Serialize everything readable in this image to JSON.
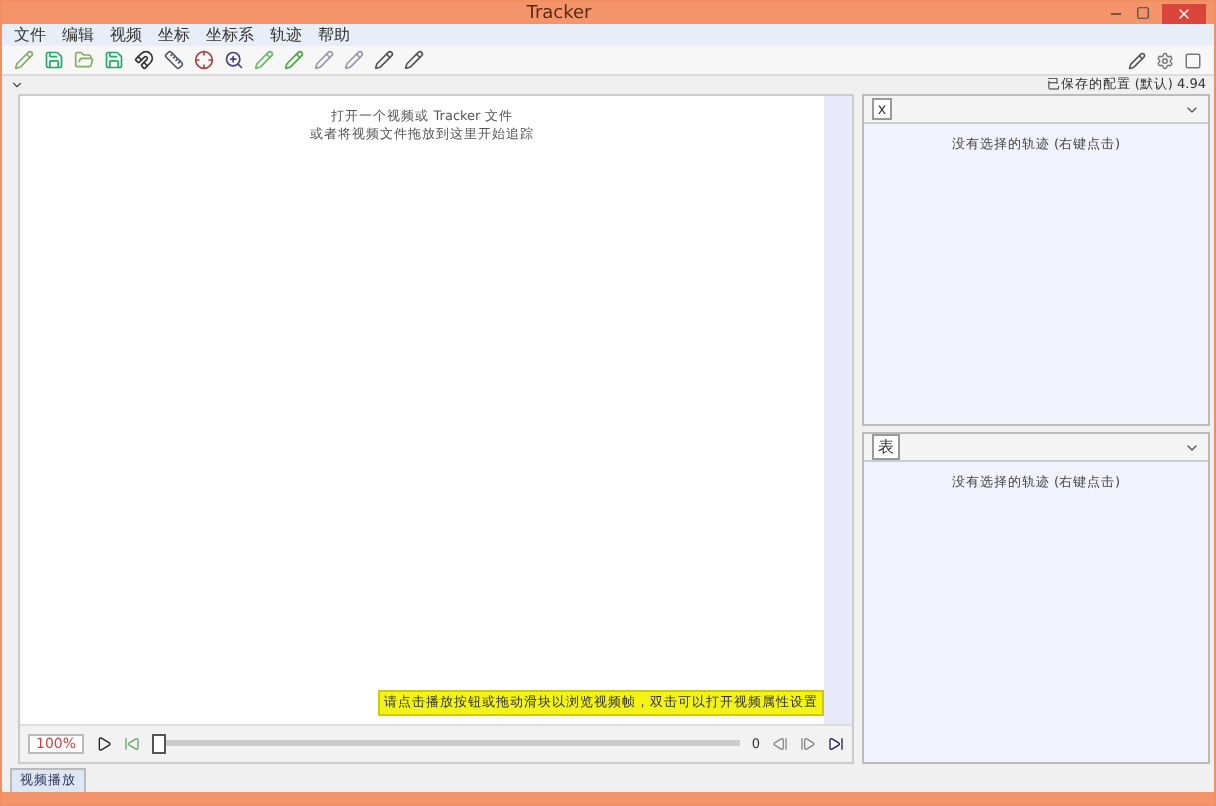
{
  "window": {
    "title": "Tracker"
  },
  "menu": [
    "文件",
    "编辑",
    "视频",
    "坐标",
    "坐标系",
    "轨迹",
    "帮助"
  ],
  "status_text": "已保存的配置 (默认) 4.94",
  "video_panel": {
    "lines": [
      "打开一个视频或 Tracker 文件",
      "或者将视频文件拖放到这里开始追踪"
    ]
  },
  "track_panels": [
    {
      "label": "x",
      "message": "没有选择的轨迹 (右键点击)"
    },
    {
      "label": "表",
      "message": "没有选择的轨迹 (右键点击)"
    }
  ],
  "hint": "请点击播放按钮或拖动滑块以浏览视频帧，双击可以打开视频属性设置",
  "player": {
    "zoom": "100%",
    "frame": "0",
    "level": 0
  },
  "bottom_tabs": [
    {
      "label": "视频播放",
      "selected": true
    }
  ]
}
